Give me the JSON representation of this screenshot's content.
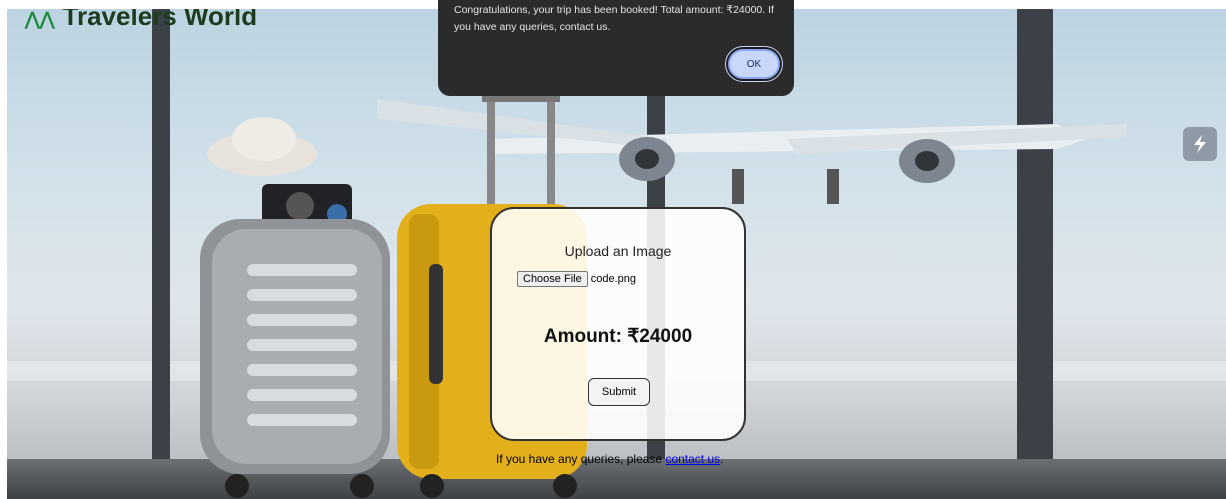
{
  "brand": {
    "name": "Travelers World"
  },
  "alert": {
    "message": "Congratulations, your trip has been booked! Total amount: ₹24000. If you have any queries, contact us.",
    "ok_label": "OK"
  },
  "upload_form": {
    "title": "Upload an Image",
    "choose_file_label": "Choose File",
    "file_name": "code.png",
    "amount_label": "Amount: ₹24000",
    "submit_label": "Submit"
  },
  "footer": {
    "text": "If you have any queries, please ",
    "link_text": "contact us",
    "suffix": "."
  },
  "icons": {
    "side_widget": "lightning-icon",
    "brand_mark": "leaf-icon"
  }
}
